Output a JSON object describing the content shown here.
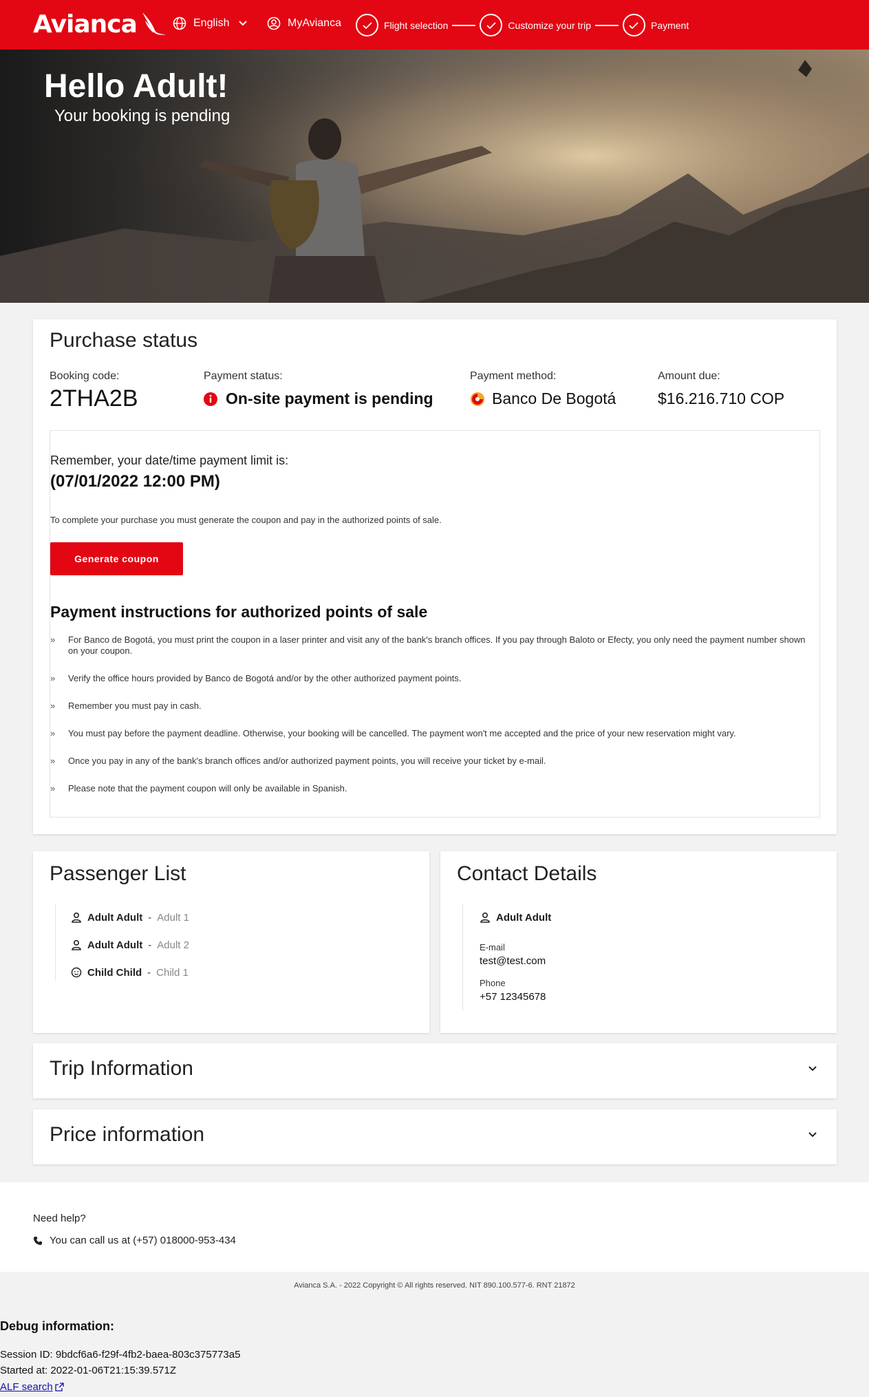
{
  "header": {
    "logo_text": "Avianca",
    "language_label": "English",
    "account_label": "MyAvianca",
    "steps": [
      {
        "label": "Flight selection"
      },
      {
        "label": "Customize your trip"
      },
      {
        "label": "Payment"
      }
    ]
  },
  "hero": {
    "title": "Hello Adult!",
    "subtitle": "Your booking is pending"
  },
  "purchase": {
    "title": "Purchase status",
    "booking_code_label": "Booking code:",
    "booking_code": "2THA2B",
    "payment_status_label": "Payment status:",
    "payment_status": "On-site payment is pending",
    "payment_method_label": "Payment method:",
    "payment_method": "Banco De Bogotá",
    "amount_due_label": "Amount due:",
    "amount_due": "$16.216.710 COP",
    "remember_text": "Remember, your date/time payment limit is:",
    "deadline": "(07/01/2022 12:00 PM)",
    "complete_text": "To complete your purchase you must generate the coupon and pay in the authorized points of sale.",
    "generate_button": "Generate coupon",
    "instructions_title": "Payment instructions for authorized points of sale",
    "instructions": [
      "For Banco de Bogotá, you must print the coupon in a laser printer and visit any of the bank's branch offices. If you pay through Baloto or Efecty, you only need the payment number shown on your coupon.",
      "Verify the office hours provided by Banco de Bogotá and/or by the other authorized payment points.",
      "Remember you must pay in cash.",
      "You must pay before the payment deadline. Otherwise, your booking will be cancelled. The payment won't me accepted and the price of your new reservation might vary.",
      "Once you pay in any of the bank's branch offices and/or authorized payment points, you will receive your ticket by e-mail.",
      "Please note that the payment coupon will only be available in Spanish."
    ],
    "bullet": "»"
  },
  "passengers": {
    "title": "Passenger List",
    "separator": "-",
    "items": [
      {
        "name": "Adult Adult",
        "type": "Adult 1",
        "icon": "person-icon"
      },
      {
        "name": "Adult Adult",
        "type": "Adult 2",
        "icon": "person-icon"
      },
      {
        "name": "Child Child",
        "type": "Child 1",
        "icon": "child-icon"
      }
    ]
  },
  "contact": {
    "title": "Contact Details",
    "name": "Adult Adult",
    "email_label": "E-mail",
    "email": "test@test.com",
    "phone_label": "Phone",
    "phone": "+57 12345678"
  },
  "trip_info": {
    "title": "Trip Information"
  },
  "price_info": {
    "title": "Price information"
  },
  "footer": {
    "need_help": "Need help?",
    "call_text": "You can call us at (+57) 018000-953-434",
    "copyright": "Avianca S.A. - 2022 Copyright © All rights reserved. NIT 890.100.577-6. RNT 21872"
  },
  "debug": {
    "title": "Debug information:",
    "session": "Session ID: 9bdcf6a6-f29f-4fb2-baea-803c375773a5",
    "started": "Started at: 2022-01-06T21:15:39.571Z",
    "link": "ALF search"
  },
  "colors": {
    "brand_red": "#e30613"
  }
}
